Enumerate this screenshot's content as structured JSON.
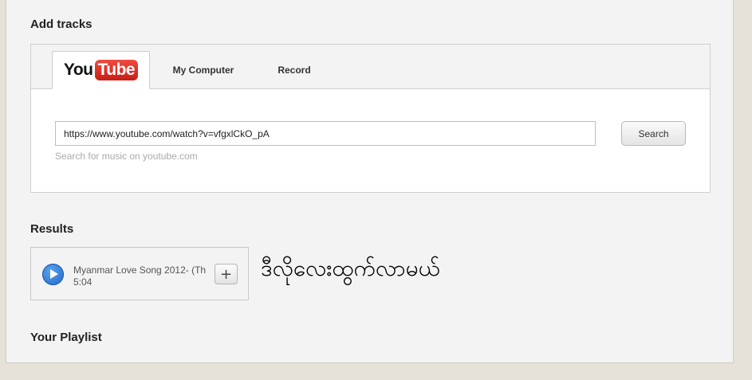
{
  "add_tracks": {
    "title": "Add tracks",
    "tabs": [
      {
        "label": "YouTube",
        "logo_you": "You",
        "logo_tube": "Tube",
        "active": true
      },
      {
        "label": "My Computer"
      },
      {
        "label": "Record"
      }
    ],
    "url_value": "https://www.youtube.com/watch?v=vfgxlCkO_pA",
    "hint": "Search for music on youtube.com",
    "search_label": "Search"
  },
  "results": {
    "title": "Results",
    "items": [
      {
        "title": "Myanmar Love Song 2012- (Th",
        "duration": "5:04",
        "add_label": "+"
      }
    ],
    "annotation": "ဒီလိုလေးထွက်လာမယ်"
  },
  "playlist": {
    "title": "Your Playlist"
  },
  "colors": {
    "background": "#e6e2d9",
    "panel": "#f3f3f3",
    "youtube_red": "#e52d27",
    "play_blue": "#1d66c7"
  }
}
